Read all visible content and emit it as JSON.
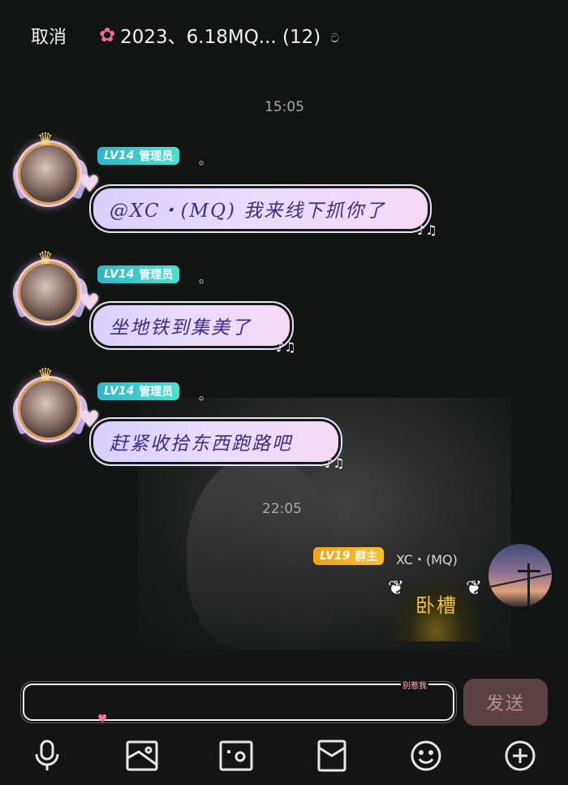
{
  "header": {
    "cancel_label": "取消",
    "title": "2023、6.18MQ... (12)",
    "flower_icon": "flower-icon",
    "ear_icon": "ear-icon"
  },
  "timestamps": [
    "15:05",
    "22:05"
  ],
  "messages": [
    {
      "badge_level": "LV14",
      "badge_role": "管理员",
      "name": "。",
      "text": "@XC・(MQ) 我来线下抓你了"
    },
    {
      "badge_level": "LV14",
      "badge_role": "管理员",
      "name": "。",
      "text": "坐地铁到集美了"
    },
    {
      "badge_level": "LV14",
      "badge_role": "管理员",
      "name": "。",
      "text": "赶紧收拾东西跑路吧"
    }
  ],
  "my_message": {
    "badge_level": "LV19",
    "badge_role": "群主",
    "name": "XC・(MQ)",
    "text": "卧槽"
  },
  "input": {
    "value": "",
    "placeholder": "",
    "tag": "别惹我",
    "send_label": "发送"
  },
  "toolbar": {
    "icons": [
      "microphone-icon",
      "image-icon",
      "camera-icon",
      "red-envelope-icon",
      "emoji-icon",
      "plus-icon"
    ]
  },
  "colors": {
    "background": "#111412",
    "admin_badge": "#3ec9cd",
    "owner_badge": "#f3b024",
    "bubble": "#e4d8ff",
    "bubble_text": "#3a2e8a",
    "send_button": "#5b4144"
  }
}
